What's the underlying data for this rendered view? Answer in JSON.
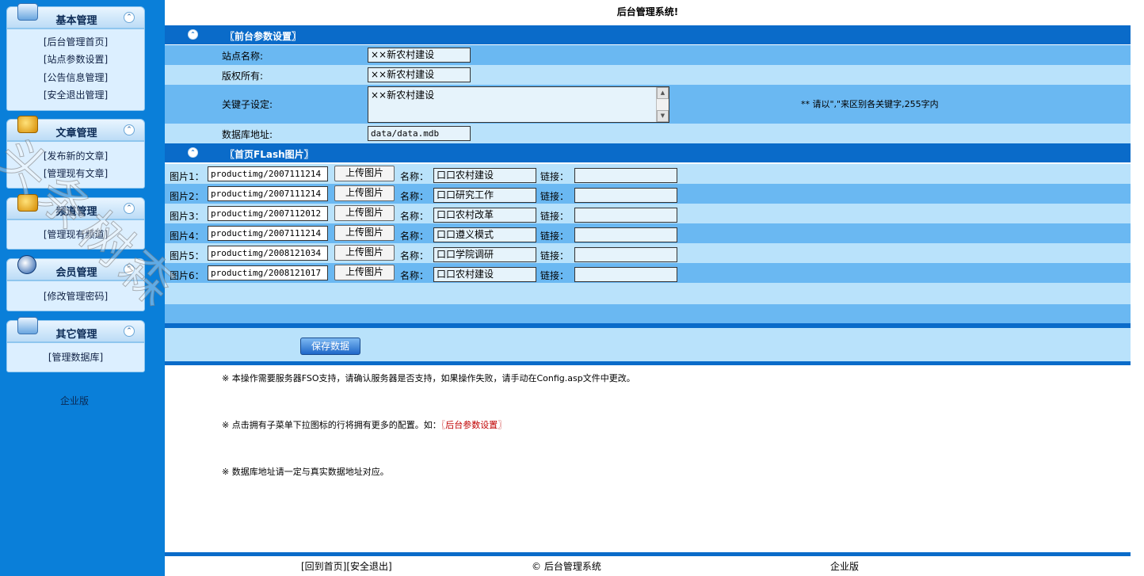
{
  "sidebar": {
    "menus": [
      {
        "title": "基本管理",
        "items": [
          "[后台管理首页]",
          "[站点参数设置]",
          "[公告信息管理]",
          "[安全退出管理]"
        ]
      },
      {
        "title": "文章管理",
        "items": [
          "[发布新的文章]",
          "[管理现有文章]"
        ]
      },
      {
        "title": "频道管理",
        "items": [
          "[管理现有频道]"
        ]
      },
      {
        "title": "会员管理",
        "items": [
          "[修改管理密码]"
        ]
      },
      {
        "title": "其它管理",
        "items": [
          "[管理数据库]"
        ]
      }
    ],
    "footer": "企业版",
    "toggle_glyph": "⌃"
  },
  "main": {
    "page_title": "后台管理系统!",
    "section1": {
      "title": "〖前台参数设置〗",
      "site_name_label": "站点名称:",
      "site_name_value": "××新农村建设",
      "copyright_label": "版权所有:",
      "copyright_value": "××新农村建设",
      "keywords_label": "关键子设定:",
      "keywords_value": "××新农村建设",
      "keywords_hint": "** 请以\",\"来区别各关键字,255字内",
      "db_label": "数据库地址:",
      "db_value": "data/data.mdb"
    },
    "section2": {
      "title": "〖首页FLash图片〗",
      "upload_label": "上传图片",
      "name_label": "名称：",
      "link_label": "链接：",
      "rows": [
        {
          "label": "图片1：",
          "path": "productimg/2007111214",
          "name": "口口农村建设",
          "link": ""
        },
        {
          "label": "图片2：",
          "path": "productimg/2007111214",
          "name": "口口研究工作",
          "link": ""
        },
        {
          "label": "图片3：",
          "path": "productimg/2007112012",
          "name": "口口农村改革",
          "link": ""
        },
        {
          "label": "图片4：",
          "path": "productimg/2007111214",
          "name": "口口遵义模式",
          "link": ""
        },
        {
          "label": "图片5：",
          "path": "productimg/2008121034",
          "name": "口口学院调研",
          "link": ""
        },
        {
          "label": "图片6：",
          "path": "productimg/2008121017",
          "name": "口口农村建设",
          "link": ""
        }
      ]
    },
    "save_button": "保存数据",
    "notes": {
      "n1": "※ 本操作需要服务器FSO支持，请确认服务器是否支持，如果操作失败，请手动在Config.asp文件中更改。",
      "n2_prefix": "※ 点击拥有子菜单下拉图标的行将拥有更多的配置。如：",
      "n2_link": "〖后台参数设置〗",
      "n3": "※ 数据库地址请一定与真实数据地址对应。"
    },
    "footer": {
      "links": "[回到首页][安全退出]",
      "copyright": "© 后台管理系统",
      "edition": "企业版"
    }
  },
  "watermark": "头条树森",
  "colors": {
    "sidebar_bg": "#0a7fd9",
    "section_head": "#0a6bc9",
    "row_light": "#b9e2fb",
    "row_mid": "#6ab8f2",
    "note_red": "#c00000"
  }
}
